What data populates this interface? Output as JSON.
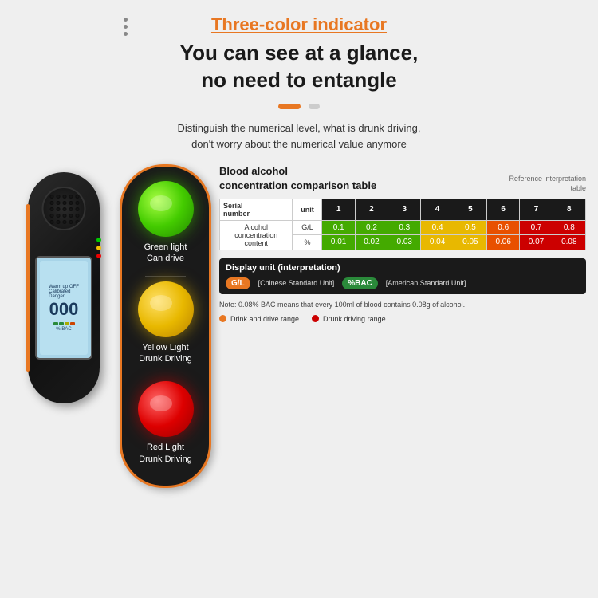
{
  "header": {
    "title_orange": "Three-color indicator",
    "title_line1": "You can see at a glance,",
    "title_line2": "no need to entangle"
  },
  "subtitle": {
    "line1": "Distinguish the numerical level, what is drunk driving,",
    "line2": "don't worry about the numerical value anymore"
  },
  "traffic_lights": [
    {
      "color": "green",
      "label_line1": "Green light",
      "label_line2": "Can drive"
    },
    {
      "color": "yellow",
      "label_line1": "Yellow Light",
      "label_line2": "Drunk Driving"
    },
    {
      "color": "red",
      "label_line1": "Red Light",
      "label_line2": "Drunk Driving"
    }
  ],
  "table": {
    "title_line1": "Blood alcohol",
    "title_line2": "concentration comparison table",
    "ref": "Reference interpretation\ntable",
    "headers": [
      "Serial\nnumber",
      "unit",
      "1",
      "2",
      "3",
      "4",
      "5",
      "6",
      "7",
      "8"
    ],
    "row1_header": "Alcohol\nconcentration\ncontent",
    "row1_unit": "G/L",
    "row1_values": [
      "0.1",
      "0.2",
      "0.3",
      "0.4",
      "0.5",
      "0.6",
      "0.7",
      "0.8"
    ],
    "row2_unit": "%",
    "row2_values": [
      "0.01",
      "0.02",
      "0.03",
      "0.04",
      "0.05",
      "0.06",
      "0.07",
      "0.08"
    ]
  },
  "display_unit": {
    "title": "Display unit (interpretation)",
    "unit1_badge": "G/L",
    "unit1_desc": "[Chinese Standard Unit]",
    "unit2_badge": "%BAC",
    "unit2_desc": "[American Standard Unit]"
  },
  "note": "Note: 0.08% BAC means that every 100ml of blood contains 0.08g of alcohol.",
  "legend": {
    "item1_label": "Drink and drive range",
    "item2_label": "Drunk driving range"
  },
  "lcd": {
    "big_number": "000",
    "unit": "BAC",
    "percent": "%"
  }
}
